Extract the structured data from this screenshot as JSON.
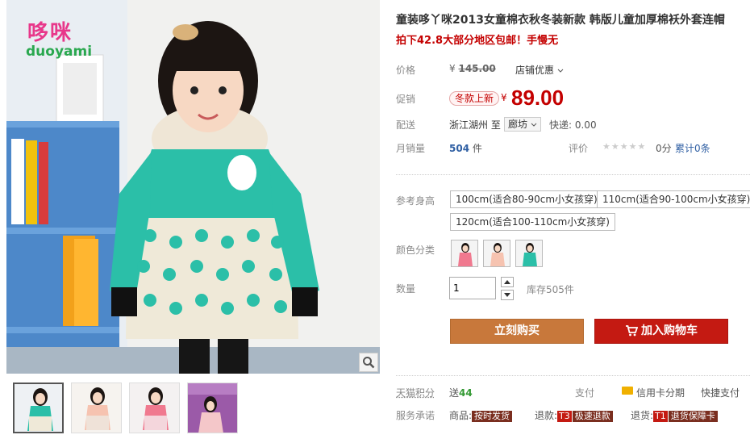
{
  "brand": {
    "logo_cn": "哆咪",
    "logo_en": "duoyami"
  },
  "product": {
    "title": "童装哆丫咪2013女童棉衣秋冬装新款 韩版儿童加厚棉袄外套连帽",
    "subtitle": "拍下42.8大部分地区包邮！手慢无"
  },
  "price": {
    "label": "价格",
    "currency": "¥",
    "original": "145.00",
    "shop_discount": "店铺优惠"
  },
  "promo": {
    "label": "促销",
    "tag": "冬款上新",
    "currency": "¥",
    "price": "89.00"
  },
  "shipping": {
    "label": "配送",
    "from": "浙江湖州",
    "to_word": "至",
    "to": "廊坊",
    "fee": "快递: 0.00"
  },
  "sales": {
    "label": "月销量",
    "count": "504",
    "unit": "件",
    "rating_label": "评价",
    "stars": "★★★★★",
    "score": "0分",
    "reviews": "累计0条"
  },
  "sizes": {
    "label": "参考身高",
    "options": [
      "100cm(适合80-90cm小女孩穿)",
      "110cm(适合90-100cm小女孩穿)",
      "120cm(适合100-110cm小女孩穿)"
    ]
  },
  "colors": {
    "label": "颜色分类",
    "swatches": [
      "pink",
      "peach",
      "mint"
    ]
  },
  "quantity": {
    "label": "数量",
    "value": "1",
    "stock": "库存505件"
  },
  "actions": {
    "buy_now": "立刻购买",
    "add_cart": "加入购物车"
  },
  "points": {
    "label": "天猫积分",
    "prefix": "送",
    "value": "44"
  },
  "payment": {
    "label": "支付",
    "credit": "信用卡分期",
    "quick": "快捷支付"
  },
  "service": {
    "label": "服务承诺",
    "items": [
      {
        "prefix": "商品:",
        "code": "",
        "tag": "按时发货"
      },
      {
        "prefix": "退款:",
        "code": "T3",
        "tag": "极速退款"
      },
      {
        "prefix": "退货:",
        "code": "T1",
        "tag": "退货保障卡"
      }
    ]
  },
  "colors_theme": {
    "price_red": "#c40000",
    "buy_orange": "#c8783b",
    "cart_red": "#c41a12",
    "link_blue": "#2f5fa3",
    "coat_mint": "#2bbfa8"
  }
}
